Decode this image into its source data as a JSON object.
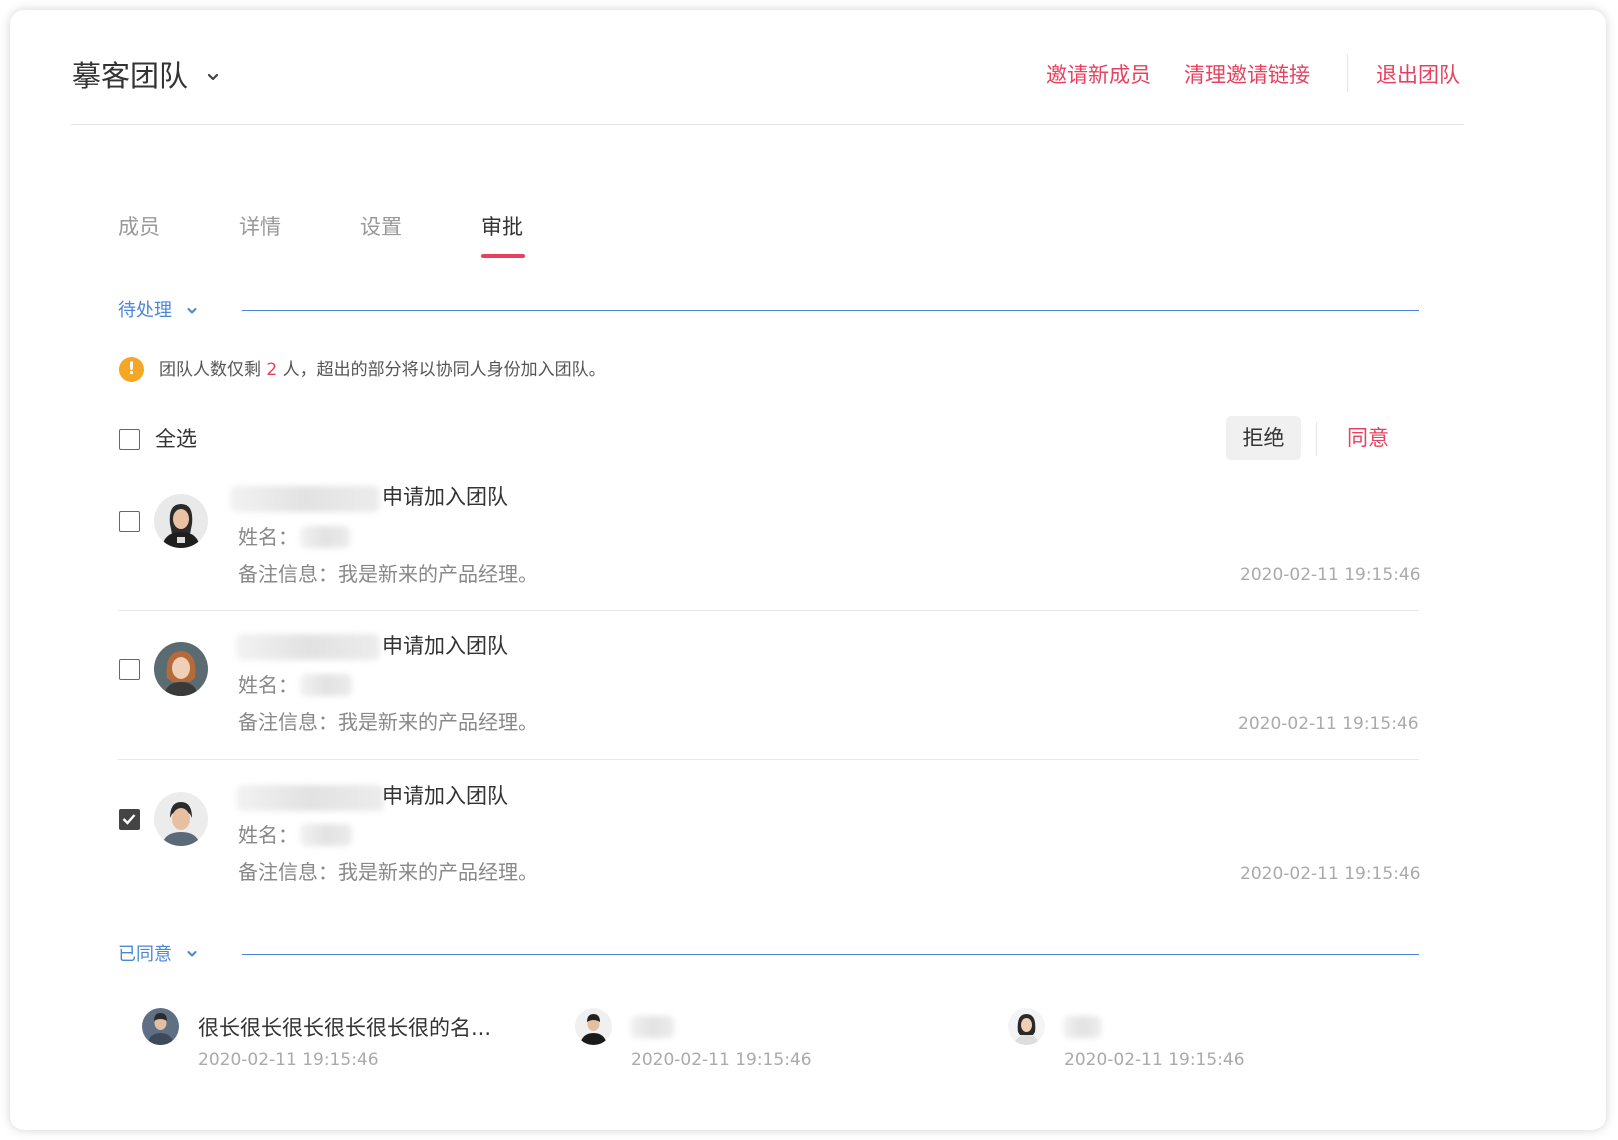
{
  "header": {
    "team_name": "摹客团队",
    "invite_label": "邀请新成员",
    "clear_links_label": "清理邀请链接",
    "leave_label": "退出团队"
  },
  "tabs": [
    {
      "label": "成员",
      "active": false
    },
    {
      "label": "详情",
      "active": false
    },
    {
      "label": "设置",
      "active": false
    },
    {
      "label": "审批",
      "active": true
    }
  ],
  "pending": {
    "section_label": "待处理",
    "notice": {
      "prefix": "团队人数仅剩",
      "count": "2",
      "suffix": "人，超出的部分将以协同人身份加入团队。"
    },
    "select_all_label": "全选",
    "reject_label": "拒绝",
    "agree_label": "同意",
    "requests": [
      {
        "title_suffix": "申请加入团队",
        "name_label": "姓名：",
        "note": "备注信息：我是新来的产品经理。",
        "time": "2020-02-11 19:15:46",
        "checked": false
      },
      {
        "title_suffix": "申请加入团队",
        "name_label": "姓名：",
        "note": "备注信息：我是新来的产品经理。",
        "time": "2020-02-11 19:15:46",
        "checked": false
      },
      {
        "title_suffix": "申请加入团队",
        "name_label": "姓名：",
        "note": "备注信息：我是新来的产品经理。",
        "time": "2020-02-11 19:15:46",
        "checked": true
      }
    ]
  },
  "approved": {
    "section_label": "已同意",
    "items": [
      {
        "name": "很长很长很长很长很长很的名...",
        "time": "2020-02-11  19:15:46"
      },
      {
        "name": "",
        "time": "2020-02-11  19:15:46"
      },
      {
        "name": "",
        "time": "2020-02-11  19:15:46"
      }
    ]
  },
  "colors": {
    "accent": "#e8415f",
    "link_blue": "#4a86d6",
    "warning": "#f5a623"
  }
}
